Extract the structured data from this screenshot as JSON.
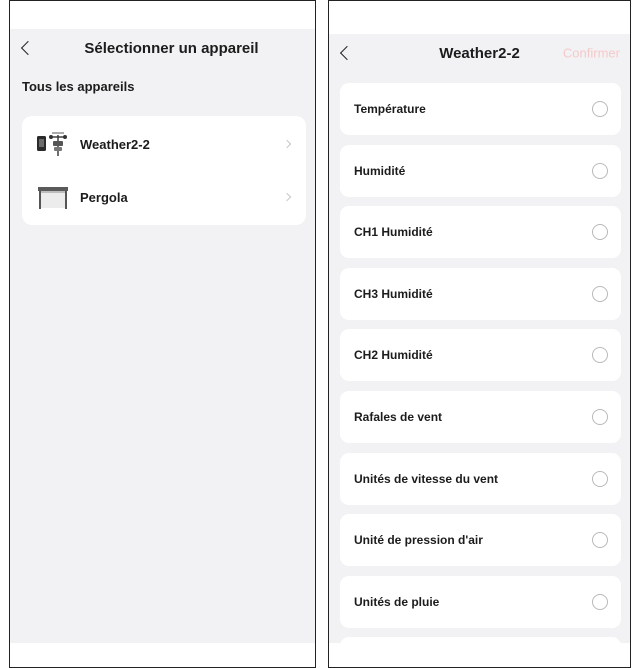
{
  "left_screen": {
    "title": "Sélectionner un appareil",
    "section_title": "Tous les appareils",
    "devices": [
      {
        "name": "Weather2-2",
        "icon": "weather-station-icon"
      },
      {
        "name": "Pergola",
        "icon": "pergola-icon"
      }
    ]
  },
  "right_screen": {
    "title": "Weather2-2",
    "confirm_label": "Confirmer",
    "items": [
      {
        "label": "Température",
        "selected": false
      },
      {
        "label": "Humidité",
        "selected": false
      },
      {
        "label": "CH1 Humidité",
        "selected": false
      },
      {
        "label": "CH3 Humidité",
        "selected": false
      },
      {
        "label": "CH2 Humidité",
        "selected": false
      },
      {
        "label": "Rafales de vent",
        "selected": false
      },
      {
        "label": "Unités de vitesse du vent",
        "selected": false
      },
      {
        "label": "Unité de pression d'air",
        "selected": false
      },
      {
        "label": "Unités de pluie",
        "selected": false
      }
    ]
  },
  "colors": {
    "background": "#f2f2f4",
    "card": "#ffffff",
    "text": "#1c1c1c",
    "confirm_disabled": "#f5c9c9",
    "radio_border": "#b9b9b9"
  }
}
